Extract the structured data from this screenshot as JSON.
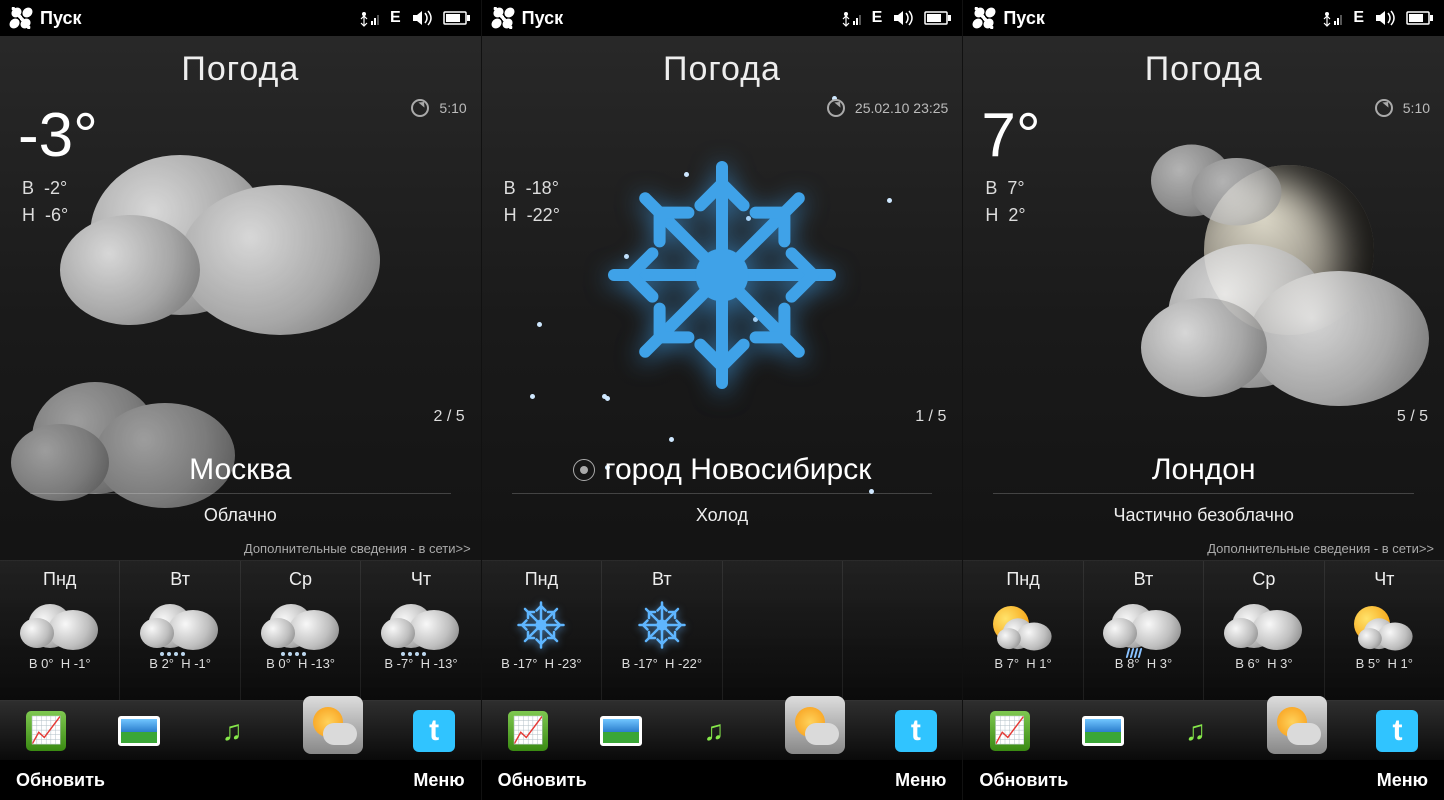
{
  "screens": [
    {
      "start": "Пуск",
      "title": "Погода",
      "timestamp": "5:10",
      "temp": "-3°",
      "high_label": "В",
      "high": "-2°",
      "low_label": "Н",
      "low": "-6°",
      "page": "2 / 5",
      "city": "Москва",
      "has_target": false,
      "condition": "Облачно",
      "more": "Дополнительные сведения - в сети>>",
      "hero_kind": "clouds",
      "more_visible": true,
      "forecast": [
        {
          "day": "Пнд",
          "icon": "cloud",
          "hi": "0°",
          "lo": "-1°"
        },
        {
          "day": "Вт",
          "icon": "cloud-snow",
          "hi": "2°",
          "lo": "-1°"
        },
        {
          "day": "Ср",
          "icon": "cloud-snow",
          "hi": "0°",
          "lo": "-13°"
        },
        {
          "day": "Чт",
          "icon": "cloud-snow",
          "hi": "-7°",
          "lo": "-13°"
        }
      ],
      "soft_left": "Обновить",
      "soft_right": "Меню"
    },
    {
      "start": "Пуск",
      "title": "Погода",
      "timestamp": "25.02.10 23:25",
      "temp": "",
      "high_label": "В",
      "high": "-18°",
      "low_label": "Н",
      "low": "-22°",
      "page": "1 / 5",
      "city": "город Новосибирск",
      "has_target": true,
      "condition": "Холод",
      "more": "",
      "hero_kind": "snowflake",
      "more_visible": false,
      "forecast": [
        {
          "day": "Пнд",
          "icon": "snowflake",
          "hi": "-17°",
          "lo": "-23°"
        },
        {
          "day": "Вт",
          "icon": "snowflake",
          "hi": "-17°",
          "lo": "-22°"
        }
      ],
      "soft_left": "Обновить",
      "soft_right": "Меню"
    },
    {
      "start": "Пуск",
      "title": "Погода",
      "timestamp": "5:10",
      "temp": "7°",
      "high_label": "В",
      "high": "7°",
      "low_label": "Н",
      "low": "2°",
      "page": "5 / 5",
      "city": "Лондон",
      "has_target": false,
      "condition": "Частично безоблачно",
      "more": "Дополнительные сведения - в сети>>",
      "hero_kind": "moon-clouds",
      "more_visible": true,
      "forecast": [
        {
          "day": "Пнд",
          "icon": "sun-cloud",
          "hi": "7°",
          "lo": "1°"
        },
        {
          "day": "Вт",
          "icon": "cloud-rain",
          "hi": "8°",
          "lo": "3°"
        },
        {
          "day": "Ср",
          "icon": "cloud",
          "hi": "6°",
          "lo": "3°"
        },
        {
          "day": "Чт",
          "icon": "sun-cloud",
          "hi": "5°",
          "lo": "1°"
        }
      ],
      "soft_left": "Обновить",
      "soft_right": "Меню"
    }
  ],
  "labels": {
    "hi": "В",
    "lo": "Н"
  },
  "status_icons": [
    "signal-icon",
    "edge-icon",
    "volume-icon",
    "battery-icon"
  ],
  "dock": [
    {
      "name": "stocks-app",
      "kind": "stocks"
    },
    {
      "name": "photos-app",
      "kind": "photo"
    },
    {
      "name": "music-app",
      "kind": "music"
    },
    {
      "name": "weather-app",
      "kind": "weather",
      "selected": true
    },
    {
      "name": "twitter-app",
      "kind": "twitter"
    }
  ]
}
